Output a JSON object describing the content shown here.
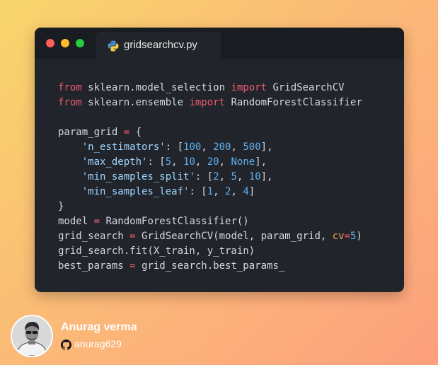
{
  "window": {
    "controls": [
      "close",
      "minimize",
      "maximize"
    ],
    "tab": {
      "icon": "python-icon",
      "filename": "gridsearchcv.py"
    }
  },
  "code": {
    "language": "python",
    "lines": [
      [
        {
          "t": "from",
          "c": "kw"
        },
        {
          "t": " sklearn.model_selection "
        },
        {
          "t": "import",
          "c": "kw"
        },
        {
          "t": " GridSearchCV"
        }
      ],
      [
        {
          "t": "from",
          "c": "kw"
        },
        {
          "t": " sklearn.ensemble "
        },
        {
          "t": "import",
          "c": "kw"
        },
        {
          "t": " RandomForestClassifier"
        }
      ],
      [],
      [
        {
          "t": "param_grid "
        },
        {
          "t": "=",
          "c": "kw"
        },
        {
          "t": " {"
        }
      ],
      [
        {
          "t": "    "
        },
        {
          "t": "'n_estimators'",
          "c": "str"
        },
        {
          "t": ": ["
        },
        {
          "t": "100",
          "c": "num"
        },
        {
          "t": ", "
        },
        {
          "t": "200",
          "c": "num"
        },
        {
          "t": ", "
        },
        {
          "t": "500",
          "c": "num"
        },
        {
          "t": "],"
        }
      ],
      [
        {
          "t": "    "
        },
        {
          "t": "'max_depth'",
          "c": "str"
        },
        {
          "t": ": ["
        },
        {
          "t": "5",
          "c": "num"
        },
        {
          "t": ", "
        },
        {
          "t": "10",
          "c": "num"
        },
        {
          "t": ", "
        },
        {
          "t": "20",
          "c": "num"
        },
        {
          "t": ", "
        },
        {
          "t": "None",
          "c": "num"
        },
        {
          "t": "],"
        }
      ],
      [
        {
          "t": "    "
        },
        {
          "t": "'min_samples_split'",
          "c": "str"
        },
        {
          "t": ": ["
        },
        {
          "t": "2",
          "c": "num"
        },
        {
          "t": ", "
        },
        {
          "t": "5",
          "c": "num"
        },
        {
          "t": ", "
        },
        {
          "t": "10",
          "c": "num"
        },
        {
          "t": "],"
        }
      ],
      [
        {
          "t": "    "
        },
        {
          "t": "'min_samples_leaf'",
          "c": "str"
        },
        {
          "t": ": ["
        },
        {
          "t": "1",
          "c": "num"
        },
        {
          "t": ", "
        },
        {
          "t": "2",
          "c": "num"
        },
        {
          "t": ", "
        },
        {
          "t": "4",
          "c": "num"
        },
        {
          "t": "]"
        }
      ],
      [
        {
          "t": "}"
        }
      ],
      [
        {
          "t": "model "
        },
        {
          "t": "=",
          "c": "kw"
        },
        {
          "t": " RandomForestClassifier()"
        }
      ],
      [
        {
          "t": "grid_search "
        },
        {
          "t": "=",
          "c": "kw"
        },
        {
          "t": " GridSearchCV(model, param_grid, "
        },
        {
          "t": "cv",
          "c": "arg"
        },
        {
          "t": "=",
          "c": "kw"
        },
        {
          "t": "5",
          "c": "num"
        },
        {
          "t": ")"
        }
      ],
      [
        {
          "t": "grid_search.fit(X_train, y_train)"
        }
      ],
      [
        {
          "t": "best_params "
        },
        {
          "t": "=",
          "c": "kw"
        },
        {
          "t": " grid_search.best_params_"
        }
      ]
    ]
  },
  "author": {
    "name": "Anurag verma",
    "github_icon": "github-icon",
    "handle": "anurag629"
  },
  "colors": {
    "background_gradient": [
      "#f8d56b",
      "#fbb878",
      "#fda07d"
    ],
    "editor_bg": "#21252b",
    "titlebar_bg": "#191c21",
    "keyword": "#ef596f",
    "string": "#9fd4ff",
    "number": "#61afef",
    "argument": "#f0a04b"
  }
}
